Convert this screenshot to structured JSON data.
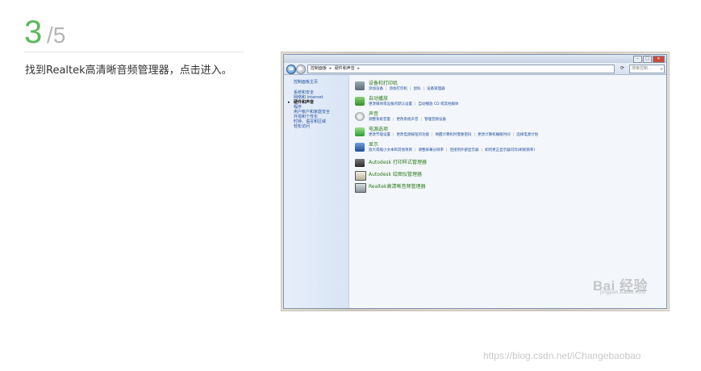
{
  "step": {
    "number": "3",
    "total": "/5"
  },
  "instruction": "找到Realtek高清晰音频管理器，点击进入。",
  "screenshot": {
    "window_buttons": [
      "–",
      "□",
      "✕"
    ],
    "nav": {
      "back": "◀",
      "forward": "▶"
    },
    "address": {
      "part1": "控制面板",
      "sep": "▸",
      "part2": "硬件和声音",
      "sep2": "▸"
    },
    "refresh": "⟳",
    "search": {
      "placeholder": "搜索控制...",
      "icon": "search-icon"
    },
    "sidebar": {
      "home": "控制面板主页",
      "items": [
        {
          "label": "系统和安全"
        },
        {
          "label": "网络和 Internet"
        },
        {
          "label": "硬件和声音"
        },
        {
          "label": "程序"
        },
        {
          "label": "用户帐户和家庭安全"
        },
        {
          "label": "外观和个性化"
        },
        {
          "label": "时钟、语言和区域"
        },
        {
          "label": "轻松访问"
        }
      ],
      "current_index": 2
    },
    "categories": [
      {
        "title": "设备和打印机",
        "icon": "printer-icon",
        "links": [
          "添加设备",
          "添加打印机",
          "鼠标",
          "设备管理器"
        ]
      },
      {
        "title": "自动播放",
        "icon": "autoplay-icon",
        "links": [
          "更改媒体或设备的默认设置",
          "自动播放 CD 或其他媒体"
        ]
      },
      {
        "title": "声音",
        "icon": "sound-icon",
        "links": [
          "调整系统音量",
          "更改系统声音",
          "管理音频设备"
        ]
      },
      {
        "title": "电源选项",
        "icon": "power-icon",
        "links": [
          "更改节能设置",
          "更改电源按钮的功能",
          "唤醒计算机时需要密码",
          "更改计算机睡眠时间",
          "选择电源计划"
        ]
      },
      {
        "title": "显示",
        "icon": "display-icon",
        "links": [
          "放大或缩小文本和其他项目",
          "调整屏幕分辨率",
          "连接到外部显示器",
          "如何更正显示器闪烁(刷新频率)"
        ]
      }
    ],
    "apps": [
      {
        "title": "Autodesk 打印样式管理器",
        "icon": "autodesk-print-style-icon"
      },
      {
        "title": "Autodesk 绘图仪管理器",
        "icon": "autodesk-plotter-icon"
      },
      {
        "title": "Realtek高清晰音频管理器",
        "icon": "realtek-audio-icon"
      }
    ]
  },
  "watermarks": {
    "baidu": "Bai 经验",
    "baidu_sub": "jingyan.baidu.com",
    "credit": "https://blog.csdn.net/iChangebaobao"
  },
  "colors": {
    "step_number": "#5cb85c",
    "step_total": "#b5b5b5",
    "link": "#1e4d99",
    "category_title": "#2d7a1c"
  }
}
